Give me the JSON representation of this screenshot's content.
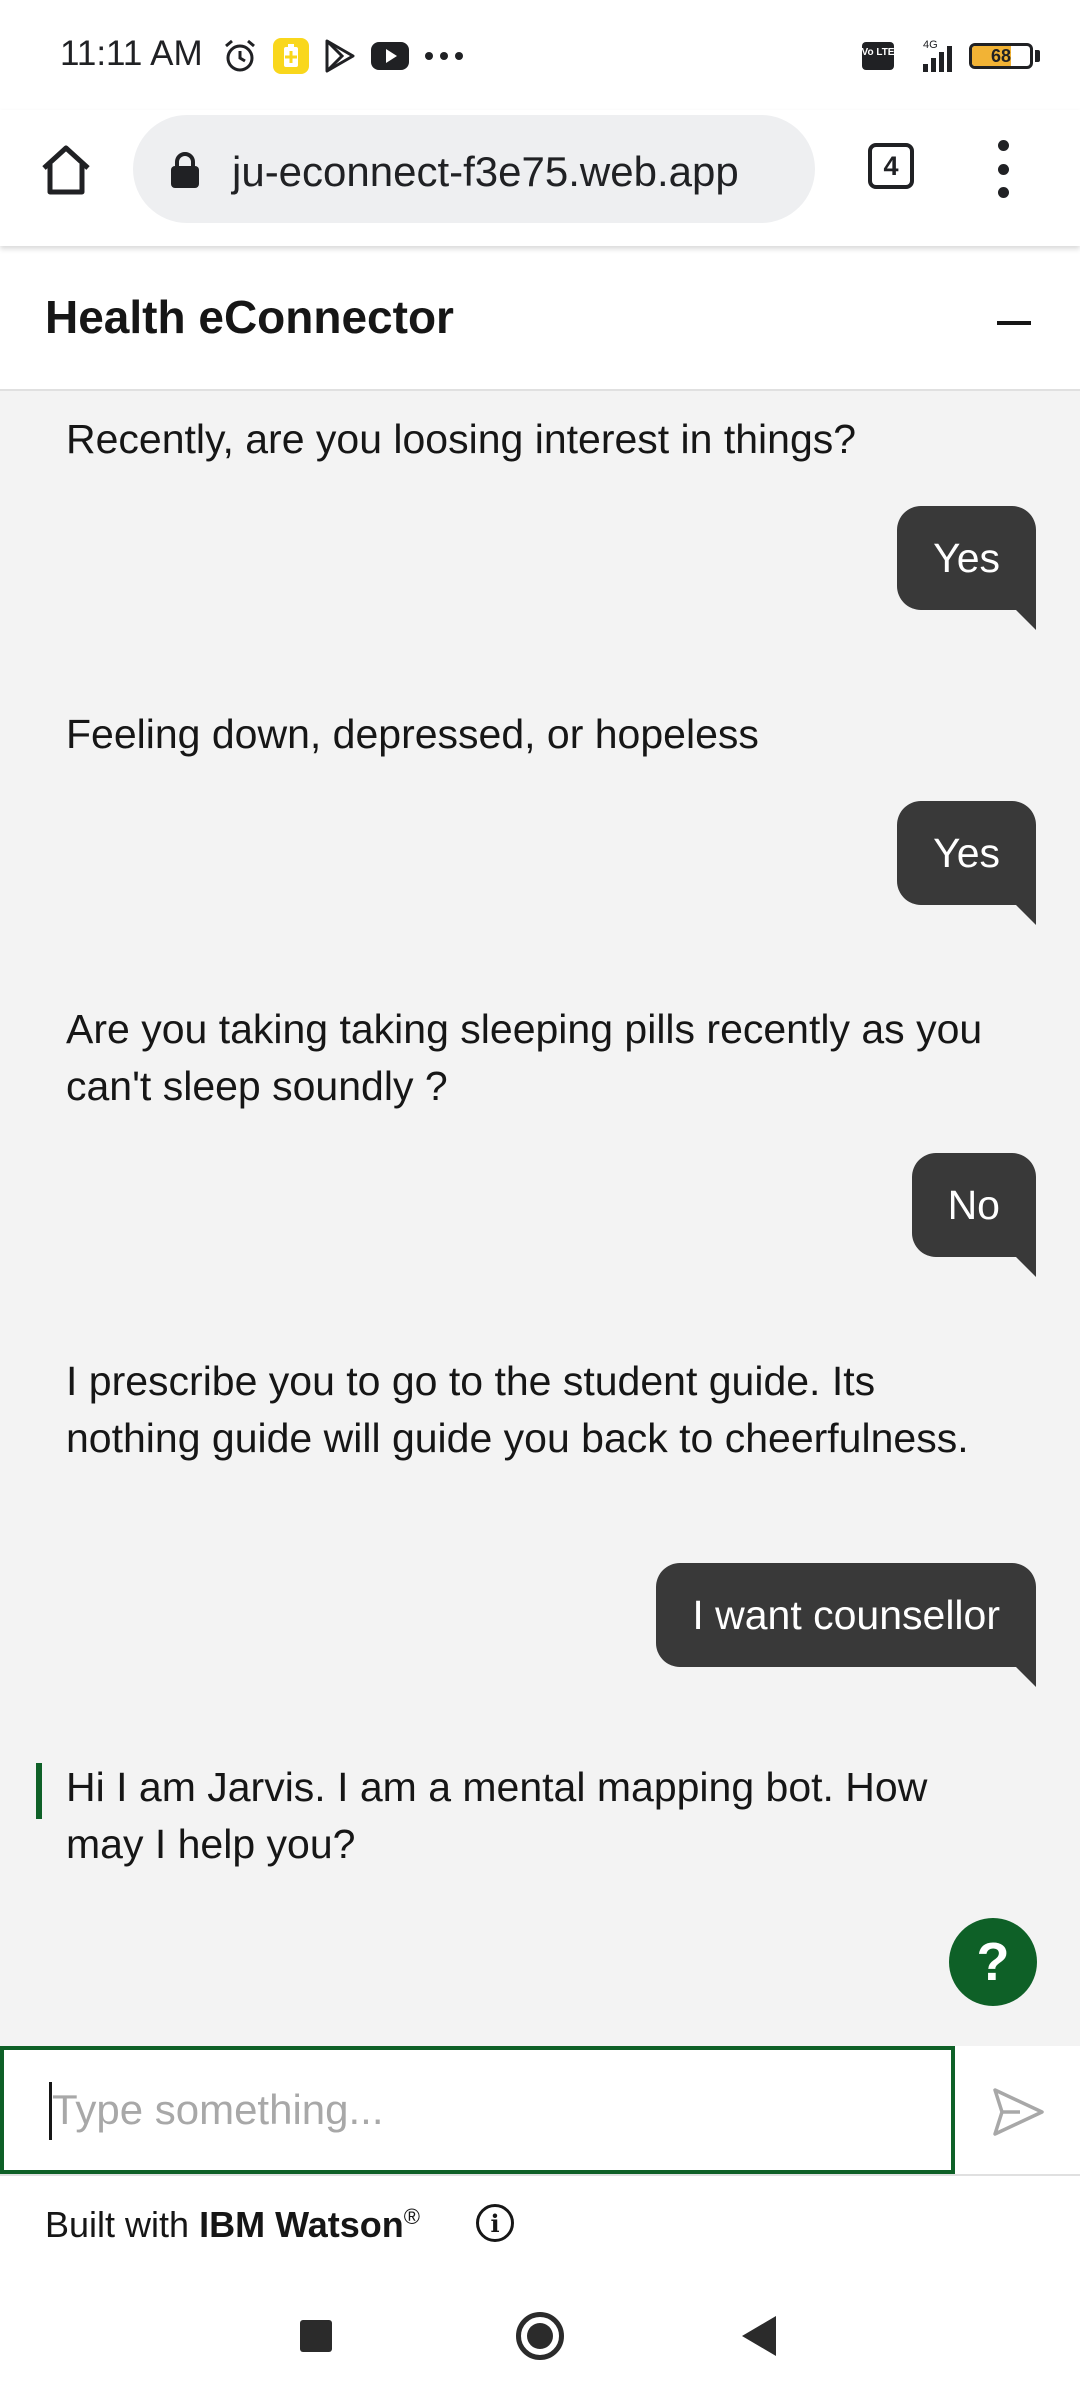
{
  "status_bar": {
    "time": "11:11 AM",
    "icons_left": [
      "alarm-icon",
      "battery-saver-icon",
      "play-store-icon",
      "youtube-icon",
      "more-icon"
    ],
    "volte": "Vo LTE",
    "network": "4G",
    "battery_level": 68,
    "battery_text": "68"
  },
  "browser": {
    "url": "ju-econnect-f3e75.web.app",
    "tab_count": "4"
  },
  "chat": {
    "title": "Health eConnector",
    "messages": [
      {
        "from": "bot",
        "text": "Recently, are you loosing interest in things?"
      },
      {
        "from": "user",
        "text": "Yes"
      },
      {
        "from": "bot",
        "text": "Feeling down, depressed, or hopeless"
      },
      {
        "from": "user",
        "text": "Yes"
      },
      {
        "from": "bot",
        "text": "Are you taking taking sleeping pills recently as you can't sleep soundly ?"
      },
      {
        "from": "user",
        "text": "No"
      },
      {
        "from": "bot",
        "text": "I prescribe you to go to the student guide. Its nothing guide will guide you back to cheerfulness."
      },
      {
        "from": "user",
        "text": "I want counsellor"
      },
      {
        "from": "bot",
        "text": "Hi I am Jarvis. I am a mental mapping bot. How may I help you?"
      }
    ],
    "help_label": "?"
  },
  "input": {
    "placeholder": "Type something...",
    "value": ""
  },
  "footer": {
    "built_with": "Built with",
    "brand": "IBM Watson",
    "reg": "®",
    "info_glyph": "i"
  },
  "colors": {
    "accent": "#0e6027",
    "user_bubble": "#393939",
    "chat_background": "#f3f3f3",
    "battery_fill": "#f2b335"
  }
}
